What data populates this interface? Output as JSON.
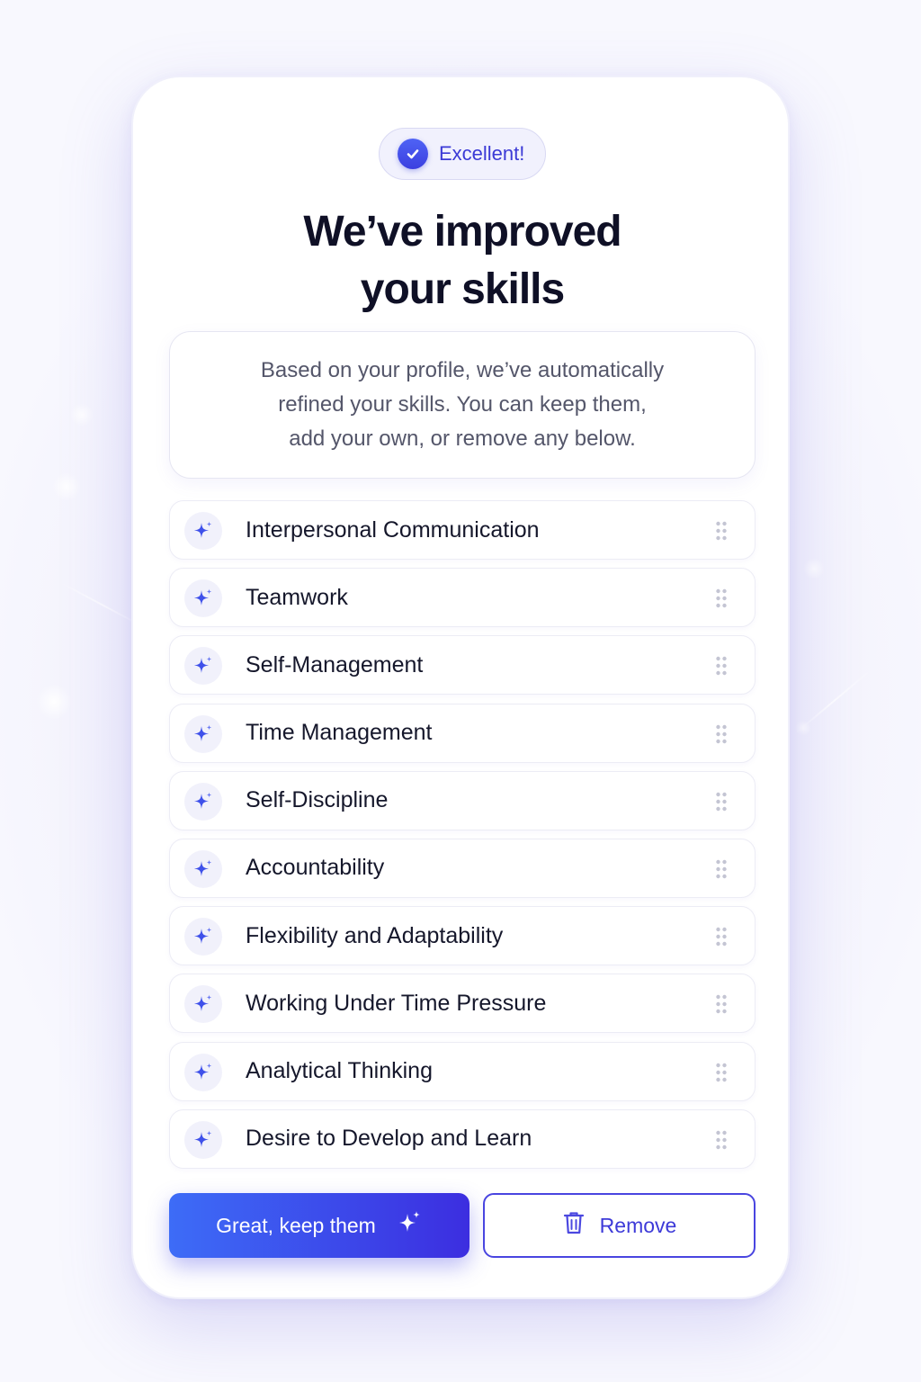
{
  "badge": {
    "label": "Excellent!"
  },
  "header": {
    "title_line1": "We’ve improved",
    "title_line2": "your skills"
  },
  "description": {
    "line1": "Based on your profile, we’ve automatically",
    "line2": "refined your skills. You can keep them,",
    "line3": "add your own, or remove any below."
  },
  "skills": [
    {
      "label": "Interpersonal Communication"
    },
    {
      "label": "Teamwork"
    },
    {
      "label": "Self-Management"
    },
    {
      "label": "Time Management"
    },
    {
      "label": "Self-Discipline"
    },
    {
      "label": "Accountability"
    },
    {
      "label": "Flexibility and Adaptability"
    },
    {
      "label": "Working Under Time Pressure"
    },
    {
      "label": "Analytical Thinking"
    },
    {
      "label": "Desire to Develop and Learn"
    }
  ],
  "actions": {
    "keep_label": "Great, keep them",
    "remove_label": "Remove"
  },
  "icons": {
    "badge": "check-circle-icon",
    "skill": "sparkle-icon",
    "handle": "drag-handle-icon",
    "keep": "sparkle-icon",
    "remove": "trash-icon"
  },
  "colors": {
    "accent": "#3b3ad6",
    "primary_gradient_start": "#3d6cf7",
    "primary_gradient_end": "#3c2ee0",
    "title": "#0f1026"
  }
}
